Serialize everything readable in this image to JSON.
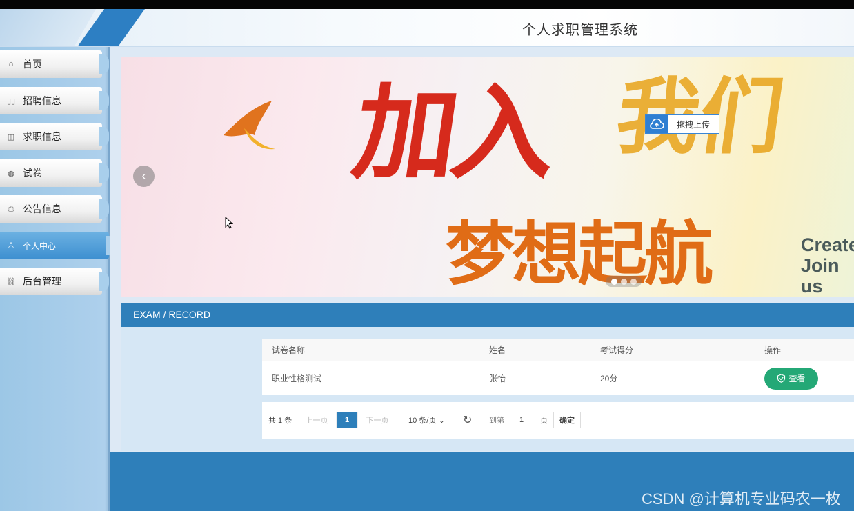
{
  "header": {
    "title": "个人求职管理系统"
  },
  "sidebar": {
    "items": [
      {
        "label": "首页",
        "icon": "home-icon",
        "glyph": "⌂"
      },
      {
        "label": "招聘信息",
        "icon": "columns-icon",
        "glyph": "▯▯"
      },
      {
        "label": "求职信息",
        "icon": "gift-icon",
        "glyph": "◫"
      },
      {
        "label": "试卷",
        "icon": "globe-icon",
        "glyph": "◍"
      },
      {
        "label": "公告信息",
        "icon": "print-icon",
        "glyph": "⎙"
      },
      {
        "label": "个人中心",
        "icon": "user-icon",
        "glyph": "♙"
      },
      {
        "label": "后台管理",
        "icon": "link-icon",
        "glyph": "⛓"
      }
    ],
    "active_index": 5
  },
  "banner": {
    "upload_label": "拖拽上传",
    "slide_count": 3,
    "active_slide": 0
  },
  "section": {
    "title": "EXAM / RECORD"
  },
  "table": {
    "columns": [
      "试卷名称",
      "姓名",
      "考试得分",
      "操作"
    ],
    "rows": [
      {
        "paper": "职业性格测试",
        "name": "张怡",
        "score": "20分",
        "action": "查看"
      }
    ]
  },
  "pager": {
    "total": "共 1 条",
    "prev": "上一页",
    "current": "1",
    "next": "下一页",
    "page_size": "10 条/页",
    "goto_label": "到第",
    "goto_value": "1",
    "page_suffix": "页",
    "confirm": "确定"
  },
  "watermark": "CSDN @计算机专业码农一枚",
  "colors": {
    "primary": "#2e7fba",
    "success": "#24a876",
    "sidebar": "#aed0ec"
  }
}
